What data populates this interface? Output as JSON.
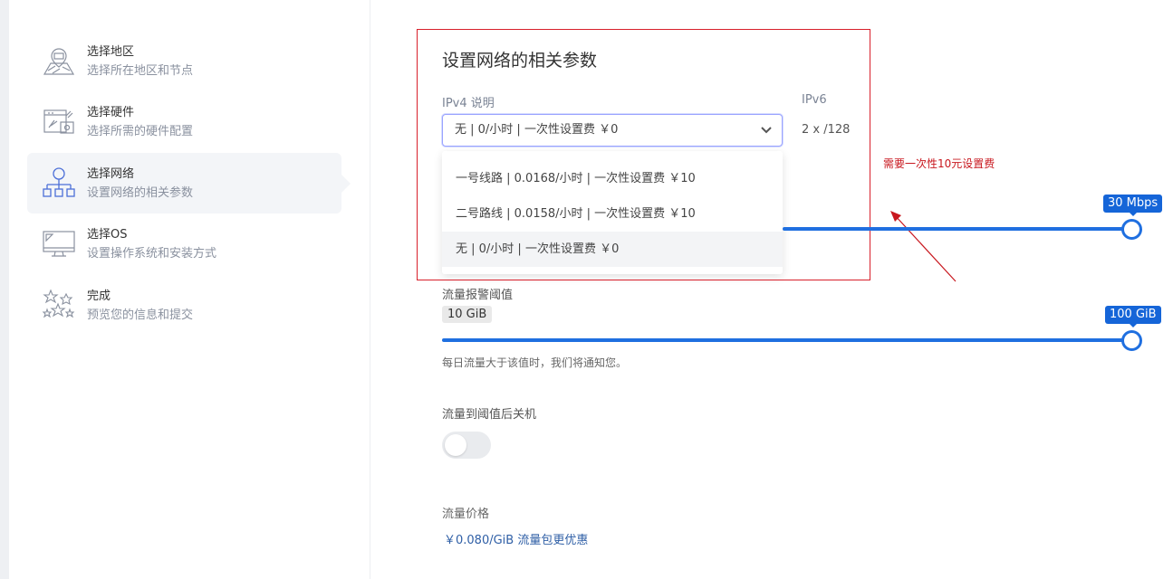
{
  "steps": [
    {
      "title": "选择地区",
      "sub": "选择所在地区和节点",
      "icon": "region-map-icon"
    },
    {
      "title": "选择硬件",
      "sub": "选择所需的硬件配置",
      "icon": "hardware-icon"
    },
    {
      "title": "选择网络",
      "sub": "设置网络的相关参数",
      "icon": "network-topology-icon"
    },
    {
      "title": "选择OS",
      "sub": "设置操作系统和安装方式",
      "icon": "monitor-icon"
    },
    {
      "title": "完成",
      "sub": "预览您的信息和提交",
      "icon": "stars-icon"
    }
  ],
  "panel": {
    "title": "设置网络的相关参数",
    "ipv4_label": "IPv4 说明",
    "ipv6_label": "IPv6",
    "ipv6_value": "2 x /128",
    "selected": "无 | 0/小时 | 一次性设置费 ￥0",
    "options": [
      "一号线路 | 0.0168/小时 | 一次性设置费 ￥10",
      "二号路线 | 0.0158/小时 | 一次性设置费 ￥10",
      "无 | 0/小时 | 一次性设置费 ￥0"
    ]
  },
  "annotation": {
    "note": "需要一次性10元设置费",
    "color": "#c8171e"
  },
  "bandwidth": {
    "tip": "30 Mbps",
    "fraction": 1.0
  },
  "traffic_alert": {
    "label": "流量报警阈值",
    "value": "10 GiB",
    "tip": "100 GiB",
    "fraction": 1.0,
    "hint": "每日流量大于该值时，我们将通知您。"
  },
  "shutdown": {
    "label": "流量到阈值后关机",
    "enabled": false
  },
  "pricing": {
    "label": "流量价格",
    "value": "￥0.080/GiB 流量包更优惠"
  },
  "colors": {
    "accent": "#1f6fe0",
    "annotation": "#c8171e"
  }
}
